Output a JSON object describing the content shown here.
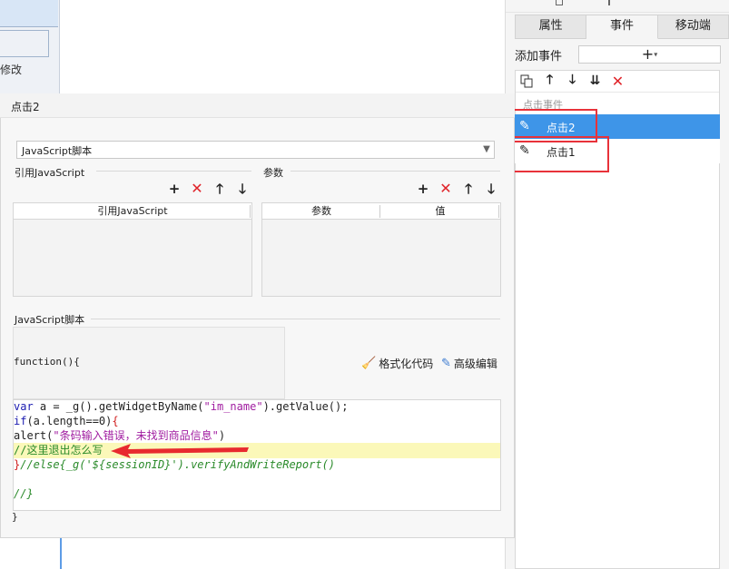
{
  "background": {
    "modify_text": "修改"
  },
  "right_panel": {
    "tabs": [
      "属性",
      "事件",
      "移动端"
    ],
    "active_tab": 1,
    "add_event_label": "添加事件",
    "add_event_button": "+",
    "event_group_label": "点击事件",
    "events": [
      {
        "label": "点击2",
        "selected": true
      },
      {
        "label": "点击1",
        "selected": false
      }
    ],
    "highlight_color": "#e8323a",
    "selected_color": "#3e95e8"
  },
  "dialog": {
    "title": "点击2",
    "script_type": "JavaScript脚本",
    "ref_section_label": "引用JavaScript",
    "param_section_label": "参数",
    "ref_table_header": "引用JavaScript",
    "param_table_headers": [
      "参数",
      "值"
    ],
    "js_section_label": "JavaScript脚本",
    "function_head": "function(){",
    "format_button": "格式化代码",
    "advanced_button": "高级编辑",
    "code": {
      "line1_kw": "var",
      "line1_a": " a = _g().getWidgetByName(",
      "line1_str": "\"im_name\"",
      "line1_b": ").getValue();",
      "line2_kw": "if",
      "line2_rest": "(a.length==0)",
      "line2_brace": "{",
      "line3_a": "alert(",
      "line3_str": "\"条码输入错误，未找到商品信息\"",
      "line3_b": ")",
      "line4": "//这里退出怎么写",
      "line5_brace": "}",
      "line5_comment": "//else{_g('${sessionID}').verifyAndWriteReport()",
      "line7": "//}"
    },
    "function_close": "}"
  }
}
